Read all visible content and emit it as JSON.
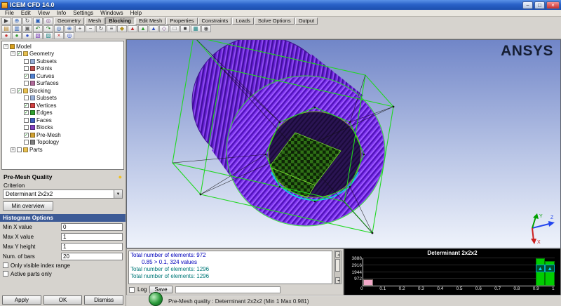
{
  "window": {
    "title": "ICEM CFD 14.0",
    "minimize_glyph": "−",
    "maximize_glyph": "□",
    "close_glyph": "×"
  },
  "menu": {
    "items": [
      "File",
      "Edit",
      "View",
      "Info",
      "Settings",
      "Windows",
      "Help"
    ]
  },
  "tab_strip": {
    "icons": [
      {
        "name": "select-pointer-icon",
        "glyph": "▶",
        "color": "#404040"
      },
      {
        "name": "zoom-select-icon",
        "glyph": "⊕",
        "color": "#2a5fb8"
      },
      {
        "name": "rotate-mode-icon",
        "glyph": "↻",
        "color": "#444444"
      },
      {
        "name": "fit-screen-icon",
        "glyph": "▣",
        "color": "#2a5fb8"
      },
      {
        "name": "display-options-icon",
        "glyph": "◎",
        "color": "#805090"
      }
    ],
    "tabs": [
      "Geometry",
      "Mesh",
      "Blocking",
      "Edit Mesh",
      "Properties",
      "Constraints",
      "Loads",
      "Solve Options",
      "Output"
    ],
    "active_tab": "Blocking"
  },
  "toolbars": {
    "row1": [
      {
        "name": "open-file-icon",
        "glyph": "▤",
        "color": "#b8862a"
      },
      {
        "name": "save-project-icon",
        "glyph": "▥",
        "color": "#2a5fb8"
      },
      {
        "name": "screen-capture-icon",
        "glyph": "▣",
        "color": "#666666"
      },
      {
        "name": "undo-icon",
        "glyph": "↶",
        "color": "#1f7a1f"
      },
      {
        "name": "redo-icon",
        "glyph": "↷",
        "color": "#1f7a1f"
      },
      {
        "name": "fit-window-icon",
        "glyph": "◎",
        "color": "#2a5fb8"
      },
      {
        "name": "box-zoom-icon",
        "glyph": "⊕",
        "color": "#2a5fb8"
      },
      {
        "name": "zoom-in-icon",
        "glyph": "+",
        "color": "#444444"
      },
      {
        "name": "zoom-out-icon",
        "glyph": "−",
        "color": "#444444"
      },
      {
        "name": "rotate-view-icon",
        "glyph": "↻",
        "color": "#444444"
      },
      {
        "name": "pan-view-icon",
        "glyph": "≡",
        "color": "#444444"
      },
      {
        "name": "measure-icon",
        "glyph": "◆",
        "color": "#b09020"
      },
      {
        "name": "view-x-icon",
        "glyph": "▲",
        "color": "#c03030"
      },
      {
        "name": "view-y-icon",
        "glyph": "▲",
        "color": "#2f9a2f"
      },
      {
        "name": "view-z-icon",
        "glyph": "▲",
        "color": "#3050c0"
      },
      {
        "name": "iso-view-icon",
        "glyph": "◇",
        "color": "#805090"
      },
      {
        "name": "wireframe-display-icon",
        "glyph": "□",
        "color": "#404040"
      },
      {
        "name": "solid-display-icon",
        "glyph": "■",
        "color": "#404040"
      },
      {
        "name": "part-colors-icon",
        "glyph": "▦",
        "color": "#2a8a8a"
      },
      {
        "name": "settings-gear-icon",
        "glyph": "◉",
        "color": "#606060"
      }
    ],
    "row2": [
      {
        "name": "geometry-display-icon",
        "glyph": "●",
        "color": "#c83030"
      },
      {
        "name": "mesh-display-icon",
        "glyph": "●",
        "color": "#2f9a2f"
      },
      {
        "name": "blocking-display-icon",
        "glyph": "●",
        "color": "#3050c8"
      },
      {
        "name": "cut-plane-icon",
        "glyph": "▧",
        "color": "#7a3fb8"
      },
      {
        "name": "scan-planes-icon",
        "glyph": "▨",
        "color": "#2a8a8a"
      },
      {
        "name": "delete-icon",
        "glyph": "×",
        "color": "#c02020"
      },
      {
        "name": "info-icon",
        "glyph": "◎",
        "color": "#3050c8"
      }
    ]
  },
  "tree": {
    "root": {
      "label": "Model",
      "icon_color": "#d8a020"
    },
    "items": [
      {
        "label": "Geometry",
        "level": 1,
        "expandable": true,
        "expanded": true,
        "checked": true,
        "icon_color": "#e8c050"
      },
      {
        "label": "Subsets",
        "level": 2,
        "checked": false,
        "icon_color": "#9ab0d8"
      },
      {
        "label": "Points",
        "level": 2,
        "checked": false,
        "icon_color": "#c05050"
      },
      {
        "label": "Curves",
        "level": 2,
        "checked": true,
        "icon_color": "#5080d0"
      },
      {
        "label": "Surfaces",
        "level": 2,
        "checked": false,
        "icon_color": "#b06a9a"
      },
      {
        "label": "Blocking",
        "level": 1,
        "expandable": true,
        "expanded": true,
        "checked": true,
        "icon_color": "#e8c050"
      },
      {
        "label": "Subsets",
        "level": 2,
        "checked": false,
        "icon_color": "#9ab0d8"
      },
      {
        "label": "Vertices",
        "level": 2,
        "checked": true,
        "icon_color": "#d04040"
      },
      {
        "label": "Edges",
        "level": 2,
        "checked": true,
        "icon_color": "#30a030"
      },
      {
        "label": "Faces",
        "level": 2,
        "checked": false,
        "icon_color": "#4060c0"
      },
      {
        "label": "Blocks",
        "level": 2,
        "checked": false,
        "icon_color": "#8040c0"
      },
      {
        "label": "Pre-Mesh",
        "level": 2,
        "checked": true,
        "icon_color": "#d0a030"
      },
      {
        "label": "Topology",
        "level": 2,
        "checked": false,
        "icon_color": "#808080"
      },
      {
        "label": "Parts",
        "level": 1,
        "expandable": true,
        "expanded": false,
        "checked": false,
        "icon_color": "#e8c050"
      }
    ]
  },
  "quality": {
    "title": "Pre-Mesh Quality",
    "criterion_label": "Criterion",
    "criterion_value": "Determinant 2x2x2",
    "min_overview_label": "Min overview"
  },
  "histogram_options": {
    "title": "Histogram Options",
    "fields": [
      {
        "name": "min-x-value",
        "label": "Min X value",
        "value": "0"
      },
      {
        "name": "max-x-value",
        "label": "Max X value",
        "value": "1"
      },
      {
        "name": "max-y-height",
        "label": "Max Y height",
        "value": "1"
      },
      {
        "name": "num-of-bars",
        "label": "Num. of bars",
        "value": "20"
      }
    ],
    "checkboxes": [
      {
        "label": "Only visible index range",
        "checked": false
      },
      {
        "label": "Active parts only",
        "checked": false
      }
    ]
  },
  "panel_buttons": [
    {
      "label": "Apply"
    },
    {
      "label": "OK"
    },
    {
      "label": "Dismiss"
    }
  ],
  "messages": {
    "lines": [
      {
        "text": "Total number of elements: 972",
        "color": "#0000bb",
        "indent": false
      },
      {
        "text": "0.85 > 0.1, 324 values",
        "color": "#0000bb",
        "indent": true
      },
      {
        "text": "Total number of elements: 1296",
        "color": "#007878",
        "indent": false
      },
      {
        "text": "Total number of elements: 1296",
        "color": "#007878",
        "indent": false
      }
    ],
    "log_label": "Log",
    "save_label": "Save"
  },
  "status": {
    "text": "Pre-Mesh quality : Determinant 2x2x2 (Min 1 Max 0.981)"
  },
  "viewport": {
    "logo": "ANSYS",
    "triad": {
      "x": "X",
      "y": "Y",
      "z": "Z"
    }
  },
  "chart_data": {
    "type": "bar",
    "title": "Determinant 2x2x2",
    "xlabel": "",
    "ylabel": "",
    "xlim": [
      0,
      1
    ],
    "ylim": [
      0,
      3888
    ],
    "x_ticks": [
      "0",
      "0.1",
      "0.2",
      "0.3",
      "0.4",
      "0.5",
      "0.6",
      "0.7",
      "0.8",
      "0.9",
      "1"
    ],
    "y_ticks": [
      972,
      1944,
      2916,
      3888
    ],
    "num_bins": 20,
    "bin_width": 0.05,
    "bins": [
      {
        "x0": 0.0,
        "x1": 0.05,
        "count": 900,
        "color": "#f2a8c8",
        "clipped": false
      },
      {
        "x0": 0.9,
        "x1": 0.95,
        "count": 3888,
        "color": "#00cc00",
        "clipped": true
      },
      {
        "x0": 0.95,
        "x1": 1.0,
        "count": 3500,
        "color": "#00cc00",
        "clipped": true
      }
    ],
    "arrow_color": "#00d8f0",
    "plot_bg": "#000000",
    "grid": true,
    "legend_position": "none"
  }
}
